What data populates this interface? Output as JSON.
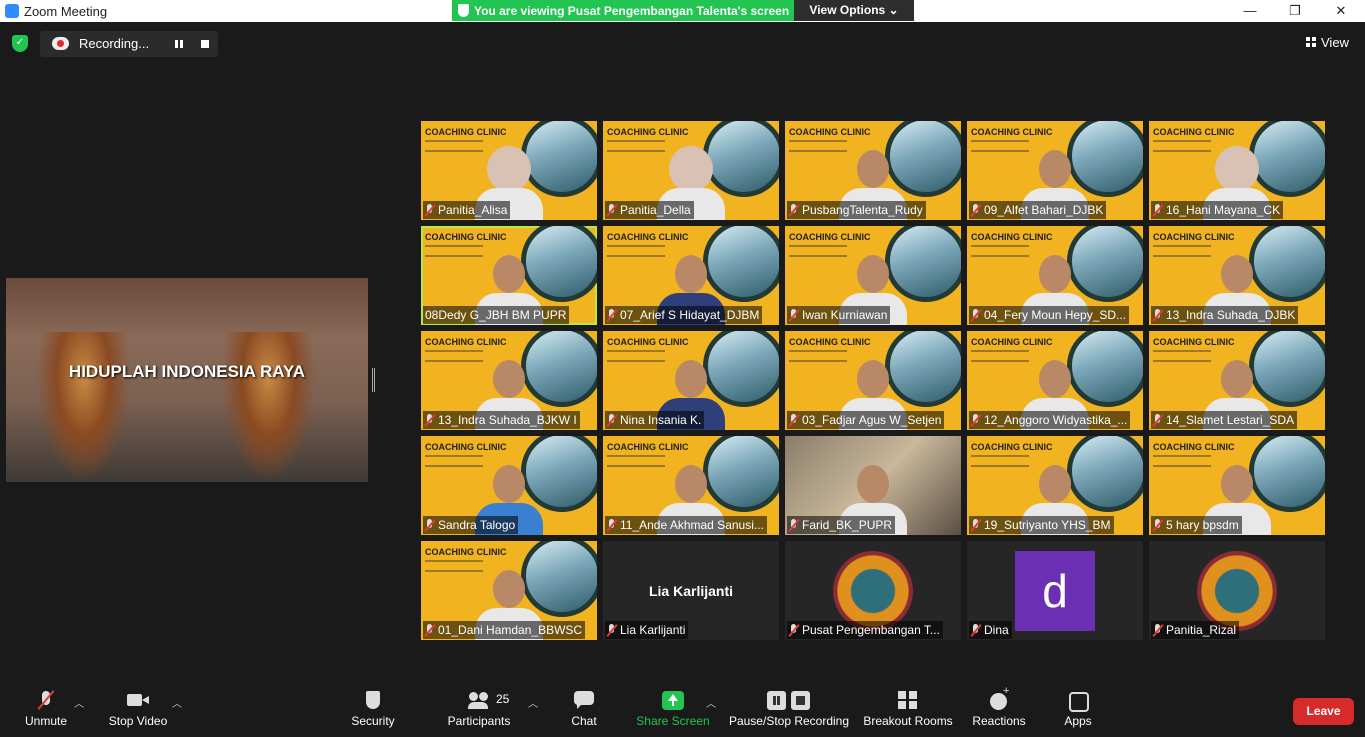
{
  "window": {
    "title": "Zoom Meeting",
    "minimize": "—",
    "maximize": "❐",
    "close": "✕"
  },
  "share_banner": {
    "text": "You are viewing Pusat Pengembangan Talenta's screen",
    "view_options": "View Options ⌄"
  },
  "recording": {
    "label": "Recording..."
  },
  "view_button": {
    "label": "View"
  },
  "shared_screen": {
    "caption": "HIDUPLAH INDONESIA RAYA"
  },
  "tile_background": {
    "title": "COACHING CLINIC"
  },
  "participants": [
    {
      "name": "Panitia_Alisa",
      "style": "cc",
      "person": "hijab"
    },
    {
      "name": "Panitia_Della",
      "style": "cc",
      "person": "hijab"
    },
    {
      "name": "PusbangTalenta_Rudy",
      "style": "cc",
      "person": "light"
    },
    {
      "name": "09_Alfet Bahari_DJBK",
      "style": "cc",
      "person": "light"
    },
    {
      "name": "16_Hani Mayana_CK",
      "style": "cc",
      "person": "hijab"
    },
    {
      "name": "08Dedy G_JBH BM PUPR",
      "style": "cc",
      "person": "light",
      "active": true,
      "muted": false
    },
    {
      "name": "07_Arief S Hidayat_DJBM",
      "style": "cc",
      "person": "dark"
    },
    {
      "name": "Iwan Kurniawan",
      "style": "cc",
      "person": "light"
    },
    {
      "name": "04_Fery Moun Hepy_SD...",
      "style": "cc",
      "person": "light"
    },
    {
      "name": "13_Indra Suhada_DJBK",
      "style": "cc",
      "person": "light"
    },
    {
      "name": "13_Indra Suhada_BJKW I",
      "style": "cc",
      "person": "light"
    },
    {
      "name": "Nina Insania K.",
      "style": "cc",
      "person": "dark"
    },
    {
      "name": "03_Fadjar Agus W_Setjen",
      "style": "cc",
      "person": "light"
    },
    {
      "name": "12_Anggoro Widyastika_...",
      "style": "cc",
      "person": "light"
    },
    {
      "name": "14_Slamet Lestari_SDA",
      "style": "cc",
      "person": "light"
    },
    {
      "name": "Sandra Talogo",
      "style": "cc",
      "person": "blue"
    },
    {
      "name": "11_Ande Akhmad Sanusi...",
      "style": "cc",
      "person": "light"
    },
    {
      "name": "Farid_BK_PUPR",
      "style": "room",
      "person": "light"
    },
    {
      "name": "19_Sutriyanto YHS_BM",
      "style": "cc",
      "person": "light"
    },
    {
      "name": "5 hary bpsdm",
      "style": "cc",
      "person": "light"
    },
    {
      "name": "01_Dani Hamdan_BBWSC",
      "style": "cc",
      "person": "light"
    },
    {
      "name": "Lia Karlijanti",
      "style": "name",
      "big_name": "Lia Karlijanti"
    },
    {
      "name": "Pusat Pengembangan T...",
      "style": "logo"
    },
    {
      "name": "Dina",
      "style": "avatar",
      "avatar_letter": "d"
    },
    {
      "name": "Panitia_Rizal",
      "style": "logo"
    }
  ],
  "toolbar": {
    "unmute": "Unmute",
    "stop_video": "Stop Video",
    "security": "Security",
    "participants": "Participants",
    "participant_count": "25",
    "chat": "Chat",
    "share_screen": "Share Screen",
    "pause_stop_recording": "Pause/Stop Recording",
    "breakout_rooms": "Breakout Rooms",
    "reactions": "Reactions",
    "apps": "Apps",
    "leave": "Leave"
  },
  "colors": {
    "accent_green": "#23c552",
    "leave_red": "#d72b2b",
    "tile_yellow": "#f2b320",
    "active_speaker": "#b5e94a"
  }
}
